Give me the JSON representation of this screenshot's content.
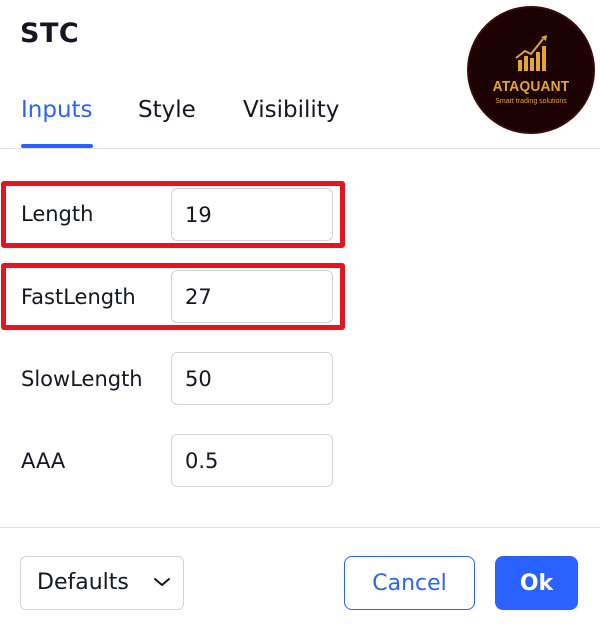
{
  "dialog": {
    "title": "STC"
  },
  "brand": {
    "name": "ATAQUANT",
    "tagline": "Smart trading solutions",
    "accent_color": "#e3a72f",
    "background_color": "#1c0202"
  },
  "tabs": [
    {
      "label": "Inputs",
      "active": true
    },
    {
      "label": "Style",
      "active": false
    },
    {
      "label": "Visibility",
      "active": false
    }
  ],
  "inputs": [
    {
      "label": "Length",
      "value": "19",
      "highlighted": true
    },
    {
      "label": "FastLength",
      "value": "27",
      "highlighted": true
    },
    {
      "label": "SlowLength",
      "value": "50",
      "highlighted": false
    },
    {
      "label": "AAA",
      "value": "0.5",
      "highlighted": false
    }
  ],
  "footer": {
    "defaults_label": "Defaults",
    "cancel_label": "Cancel",
    "ok_label": "Ok"
  },
  "colors": {
    "accent": "#2962ff",
    "highlight": "#e4151f",
    "text": "#131722",
    "border": "#d1d4dc"
  }
}
